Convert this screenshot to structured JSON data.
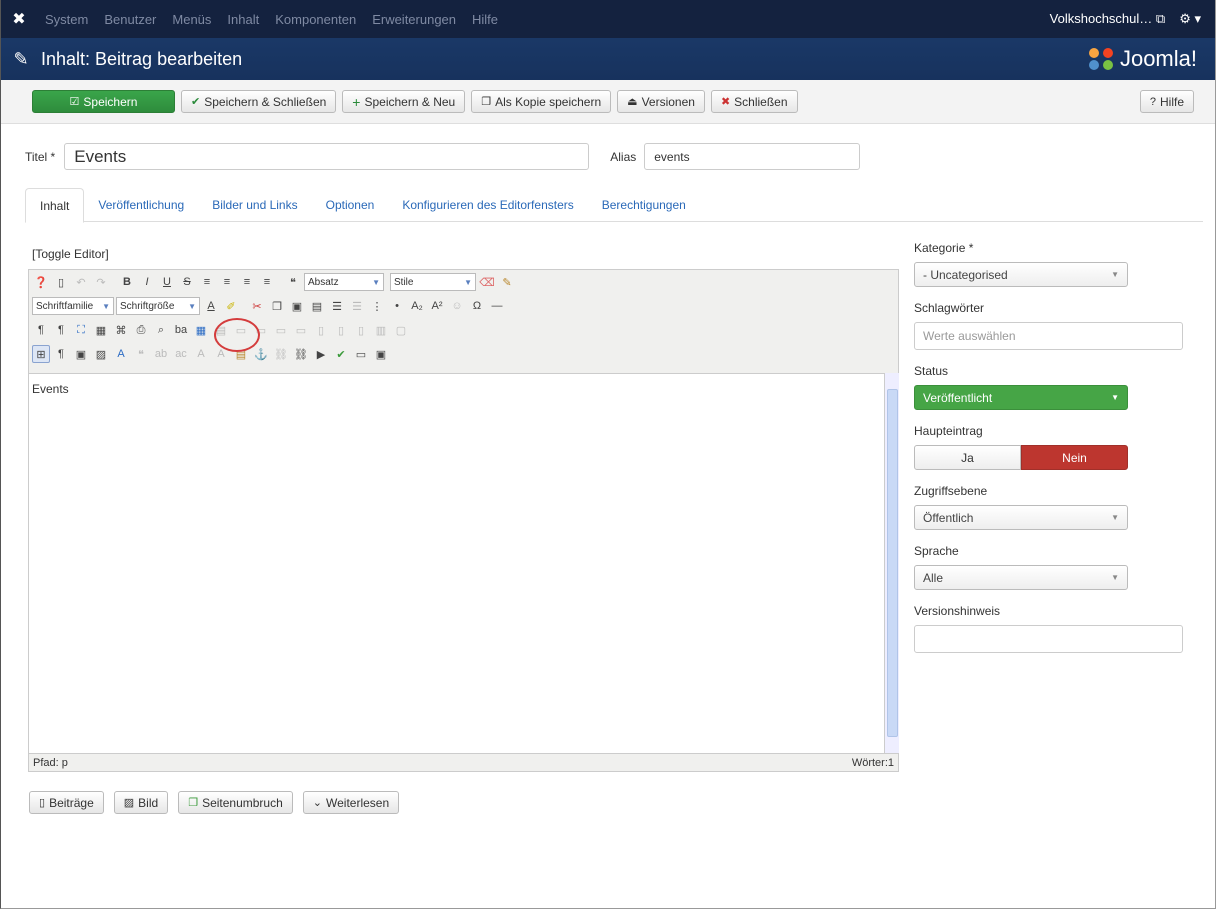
{
  "topbar": {
    "menu": [
      "System",
      "Benutzer",
      "Menüs",
      "Inhalt",
      "Komponenten",
      "Erweiterungen",
      "Hilfe"
    ],
    "site": "Volkshochschul…",
    "site_icon": "external-link-icon",
    "settings_icon": "gear-icon"
  },
  "header": {
    "title": "Inhalt: Beitrag bearbeiten",
    "logo_text": "Joomla!"
  },
  "toolbar": {
    "save": "Speichern",
    "save_close": "Speichern & Schließen",
    "save_new": "Speichern & Neu",
    "save_copy": "Als Kopie speichern",
    "versions": "Versionen",
    "close": "Schließen",
    "help": "Hilfe"
  },
  "form": {
    "title_label": "Titel *",
    "title_value": "Events",
    "alias_label": "Alias",
    "alias_value": "events"
  },
  "tabs": [
    "Inhalt",
    "Veröffentlichung",
    "Bilder und Links",
    "Optionen",
    "Konfigurieren des Editorfensters",
    "Berechtigungen"
  ],
  "editor": {
    "toggle": "[Toggle Editor]",
    "format_select": "Absatz",
    "style_select": "Stile",
    "font_family": "Schriftfamilie",
    "font_size": "Schriftgröße",
    "content": "Events",
    "path": "Pfad: p",
    "words": "Wörter:1"
  },
  "bottom_buttons": {
    "articles": "Beiträge",
    "image": "Bild",
    "pagebreak": "Seitenumbruch",
    "readmore": "Weiterlesen"
  },
  "sidebar": {
    "category_label": "Kategorie *",
    "category_value": "- Uncategorised",
    "tags_label": "Schlagwörter",
    "tags_placeholder": "Werte auswählen",
    "status_label": "Status",
    "status_value": "Veröffentlicht",
    "featured_label": "Haupteintrag",
    "featured_yes": "Ja",
    "featured_no": "Nein",
    "access_label": "Zugriffsebene",
    "access_value": "Öffentlich",
    "language_label": "Sprache",
    "language_value": "Alle",
    "version_note_label": "Versionshinweis",
    "version_note_value": ""
  },
  "colors": {
    "save": "#3aa54a",
    "status": "#46a546",
    "nein": "#bd362f",
    "header": "#1a3867",
    "topbar": "#14223f"
  }
}
